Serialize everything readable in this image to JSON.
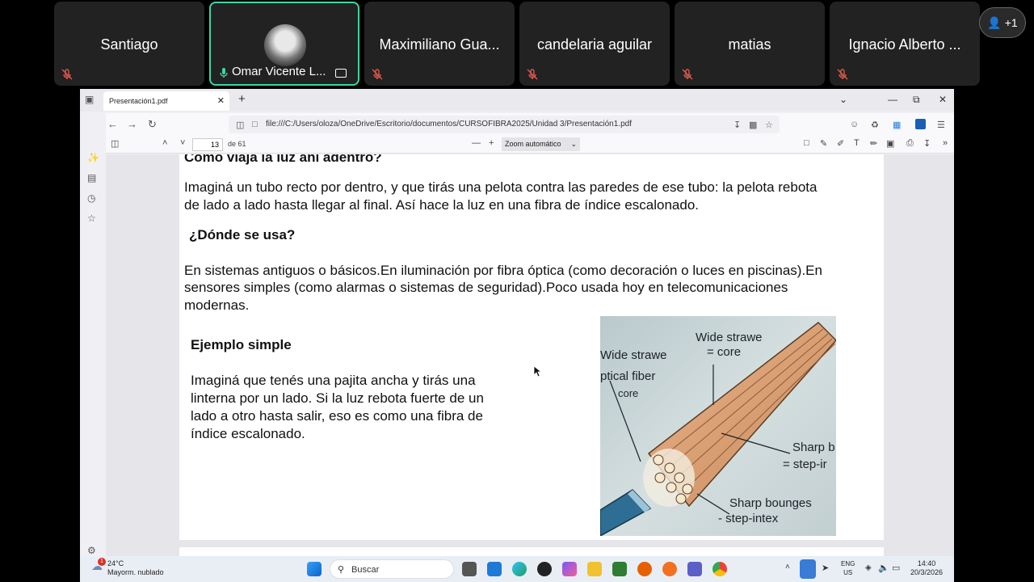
{
  "participants": [
    {
      "name": "Santiago",
      "muted": true
    },
    {
      "name": "Omar Vicente L...",
      "muted": false,
      "active": true
    },
    {
      "name": "Maximiliano Gua...",
      "muted": true
    },
    {
      "name": "candelaria aguilar",
      "muted": true
    },
    {
      "name": "matias",
      "muted": true
    },
    {
      "name": "Ignacio Alberto ...",
      "muted": true
    }
  ],
  "more_participants": "+1",
  "browser": {
    "tab_title": "Presentación1.pdf",
    "url": "file:///C:/Users/oloza/OneDrive/Escritorio/documentos/CURSOFIBRA2025/Unidad 3/Presentación1.pdf"
  },
  "pdf_toolbar": {
    "page_number": "13",
    "page_total": "de 61",
    "zoom": "Zoom automático"
  },
  "slide": {
    "heading_top": "Cómo viaja la luz ahí adentro?",
    "para1_line1": "Imaginá un tubo recto por dentro, y que tirás una pelota contra las paredes de ese tubo: la pelota rebota",
    "para1_line2": "de lado a lado hasta llegar al final. Así hace la luz en una fibra de índice escalonado.",
    "heading_where": "¿Dónde se usa?",
    "para2_line1": "En sistemas antiguos o básicos.En iluminación por fibra óptica (como decoración o luces en piscinas).En",
    "para2_line2": "sensores simples (como alarmas o sistemas de seguridad).Poco usada hoy en telecomunicaciones",
    "para2_line3": "modernas.",
    "heading_example": "Ejemplo simple",
    "para3_line1": "Imaginá que tenés una pajita ancha y tirás una",
    "para3_line2": "linterna por un lado. Si la luz rebota fuerte de un",
    "para3_line3": "lado a otro hasta salir, eso es como una fibra de",
    "para3_line4": "índice escalonado.",
    "figure_labels": {
      "wide_straw_top": "Wide strawe",
      "core_top": "= core",
      "wide_straw_left": "Wide strawe",
      "optical_fiber": "ptical fiber",
      "core_left": "core",
      "sharp_right": "Sharp b",
      "step_right": "= step-ir",
      "sharp_bottom": "Sharp bounges",
      "step_bottom": "- step-intex"
    }
  },
  "taskbar": {
    "temperature": "24°C",
    "weather": "Mayorm. nublado",
    "weather_badge": "1",
    "search_placeholder": "Buscar",
    "lang": "ENG",
    "region": "US",
    "time": "14:40",
    "date": "20/3/2026"
  },
  "colors": {
    "active_speaker_border": "#3fd3a6",
    "tile_bg": "#222222",
    "mute_icon": "#e0584b"
  }
}
